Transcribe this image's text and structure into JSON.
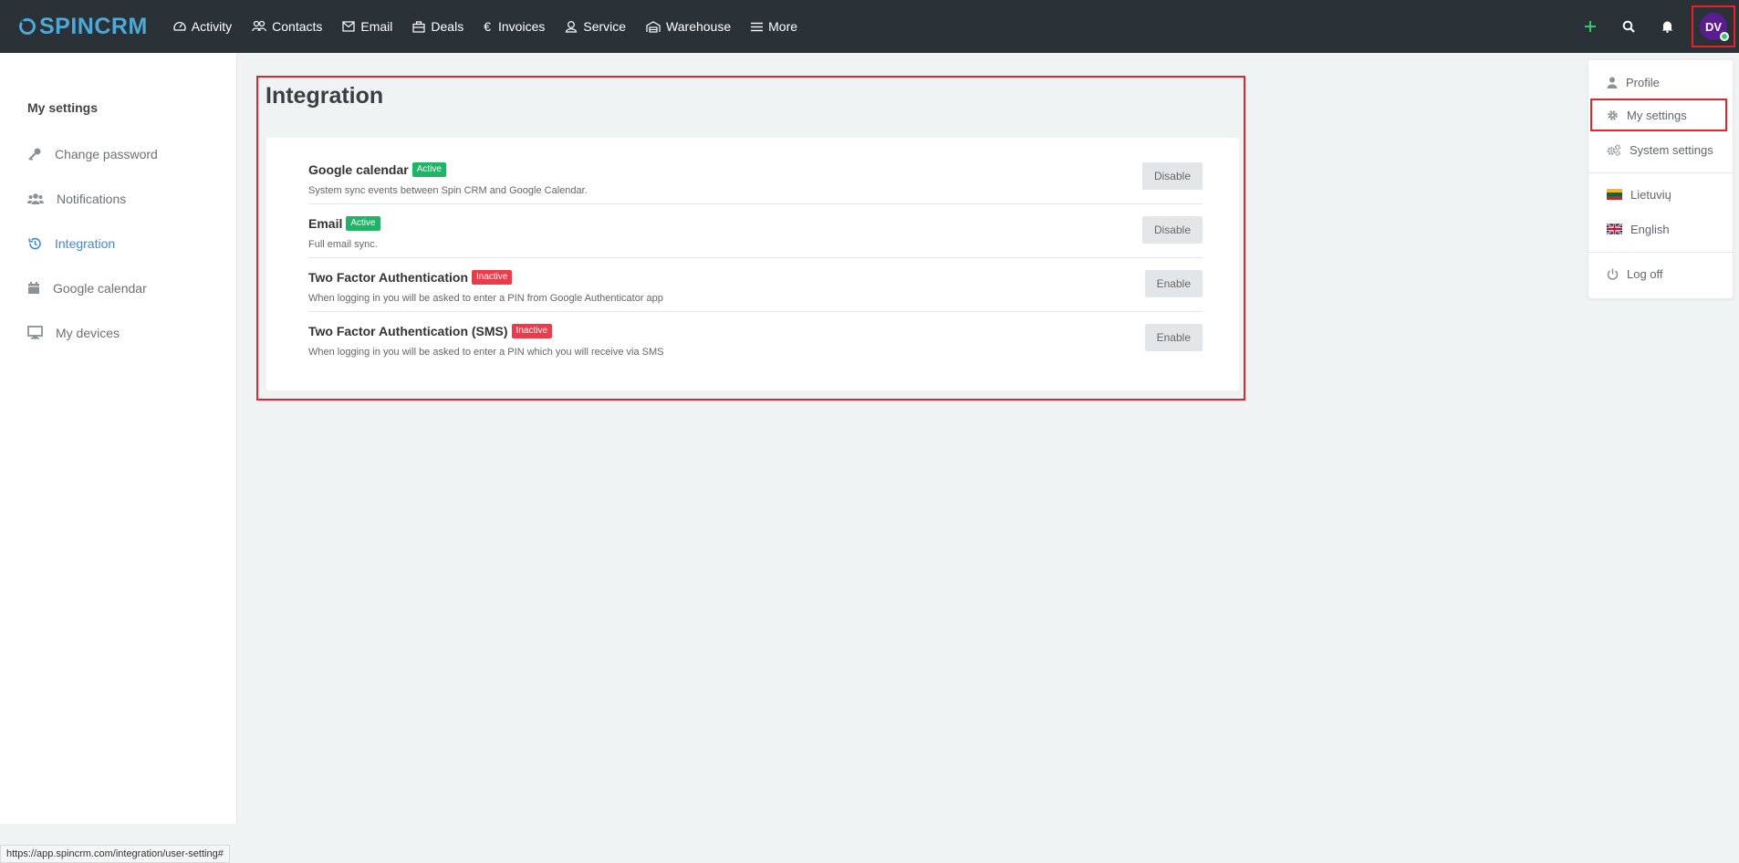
{
  "brand": {
    "spin": "SPIN",
    "crm": "CRM"
  },
  "nav": {
    "items": [
      {
        "label": "Activity",
        "icon": "gauge-icon"
      },
      {
        "label": "Contacts",
        "icon": "users-icon"
      },
      {
        "label": "Email",
        "icon": "envelope-icon"
      },
      {
        "label": "Deals",
        "icon": "briefcase-icon"
      },
      {
        "label": "Invoices",
        "icon": "euro-icon"
      },
      {
        "label": "Service",
        "icon": "user-service-icon"
      },
      {
        "label": "Warehouse",
        "icon": "warehouse-icon"
      },
      {
        "label": "More",
        "icon": "menu-icon"
      }
    ],
    "avatar_initials": "DV"
  },
  "sidebar": {
    "title": "My settings",
    "items": [
      {
        "label": "Change password",
        "icon": "key-icon"
      },
      {
        "label": "Notifications",
        "icon": "users-icon"
      },
      {
        "label": "Integration",
        "icon": "history-icon"
      },
      {
        "label": "Google calendar",
        "icon": "calendar-icon"
      },
      {
        "label": "My devices",
        "icon": "monitor-icon"
      }
    ]
  },
  "main": {
    "title": "Integration",
    "integrations": [
      {
        "name": "Google calendar",
        "status": "Active",
        "description": "System sync events between Spin CRM and Google Calendar.",
        "button": "Disable"
      },
      {
        "name": "Email",
        "status": "Active",
        "description": "Full email sync.",
        "button": "Disable"
      },
      {
        "name": "Two Factor Authentication",
        "status": "Inactive",
        "description": "When logging in you will be asked to enter a PIN from Google Authenticator app",
        "button": "Enable"
      },
      {
        "name": "Two Factor Authentication (SMS)",
        "status": "Inactive",
        "description": "When logging in you will be asked to enter a PIN which you will receive via SMS",
        "button": "Enable"
      }
    ]
  },
  "dropdown": {
    "profile": "Profile",
    "my_settings": "My settings",
    "system_settings": "System settings",
    "lang_lt": "Lietuvių",
    "lang_en": "English",
    "logoff": "Log off"
  },
  "statusbar": {
    "url": "https://app.spincrm.com/integration/user-setting#"
  },
  "colors": {
    "accent": "#4ea8d8",
    "active": "#21b466",
    "inactive": "#ee3b4c",
    "highlight": "#e5232b"
  }
}
